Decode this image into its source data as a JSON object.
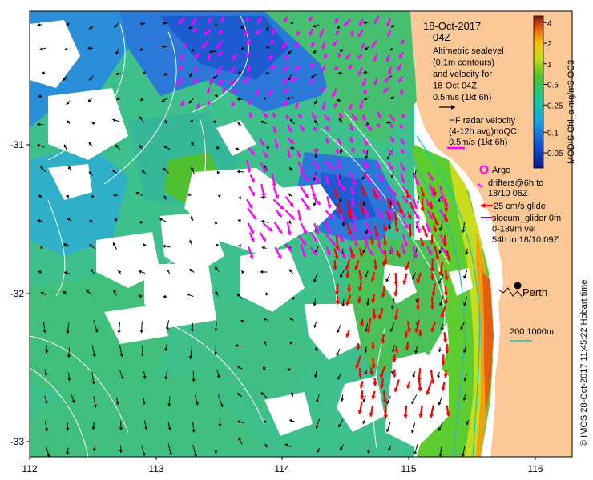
{
  "map": {
    "title_date": "18-Oct-2017",
    "title_time": "04Z",
    "x_ticks": [
      "112",
      "113",
      "114",
      "115",
      "116"
    ],
    "y_ticks": [
      "-31",
      "-32",
      "-33"
    ],
    "legend_lines": [
      "Altimetric sealevel",
      "(0.1m contours)",
      "and velocity for",
      "18-Oct 04Z",
      "0.5m/s (1kt 6h)"
    ],
    "hf_lines": [
      "HF radar velocity",
      "(4-12h avg)noQC",
      "0.5m/s (1kt 6h)"
    ],
    "argo_label": "Argo",
    "drifter_lines": [
      "drifters@6h to",
      "18/10 06Z"
    ],
    "glide_label": "25 cm/s glide",
    "glider_lines": [
      "slocum_glider 0m",
      "0-139m vel",
      "54h to 18/10 09Z"
    ],
    "city": "Perth",
    "isobath_label": "200  1000m",
    "colorbar_label": "MODIS Chl_a mg/m3 OC3",
    "colorbar_ticks": [
      "4",
      "2",
      "1",
      "0.5",
      "0.25",
      "0.1",
      "0.05"
    ],
    "credit": "© IMOS 28-Oct-2017 11:45:22 Hobart time",
    "colors": {
      "land": "#fcc898",
      "hf_arrow": "#ff00ff",
      "drifter_arrow": "#ff0000",
      "alt_arrow": "#000000",
      "contour": "#ffffff",
      "isobath_200": "#00cccc",
      "isobath_1000": "#33aadd"
    }
  }
}
